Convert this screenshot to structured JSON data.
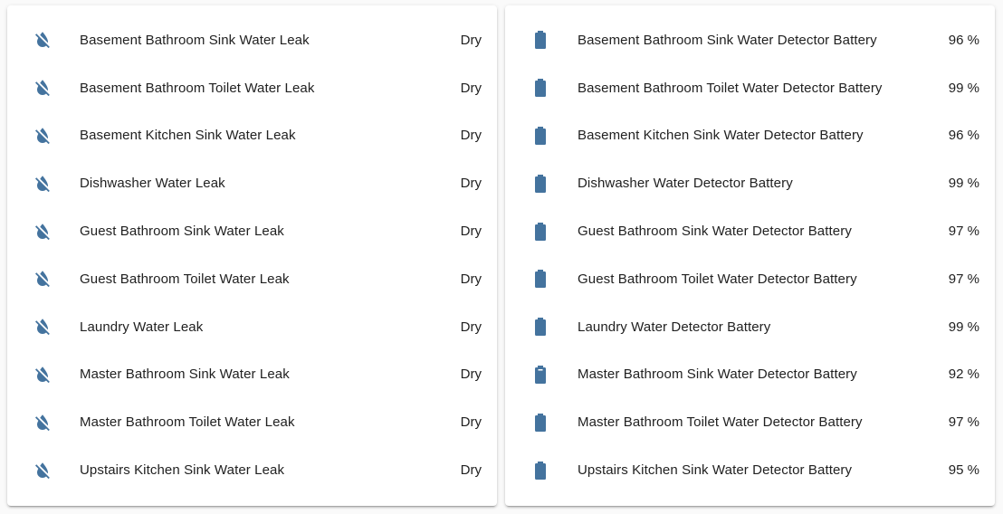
{
  "theme": {
    "icon_color": "#44739e"
  },
  "leak_card": {
    "rows": [
      {
        "name": "Basement Bathroom Sink Water Leak",
        "state": "Dry",
        "icon": "water-off-icon"
      },
      {
        "name": "Basement Bathroom Toilet Water Leak",
        "state": "Dry",
        "icon": "water-off-icon"
      },
      {
        "name": "Basement Kitchen Sink Water Leak",
        "state": "Dry",
        "icon": "water-off-icon"
      },
      {
        "name": "Dishwasher Water Leak",
        "state": "Dry",
        "icon": "water-off-icon"
      },
      {
        "name": "Guest Bathroom Sink Water Leak",
        "state": "Dry",
        "icon": "water-off-icon"
      },
      {
        "name": "Guest Bathroom Toilet Water Leak",
        "state": "Dry",
        "icon": "water-off-icon"
      },
      {
        "name": "Laundry Water Leak",
        "state": "Dry",
        "icon": "water-off-icon"
      },
      {
        "name": "Master Bathroom Sink Water Leak",
        "state": "Dry",
        "icon": "water-off-icon"
      },
      {
        "name": "Master Bathroom Toilet Water Leak",
        "state": "Dry",
        "icon": "water-off-icon"
      },
      {
        "name": "Upstairs Kitchen Sink Water Leak",
        "state": "Dry",
        "icon": "water-off-icon"
      }
    ]
  },
  "battery_card": {
    "rows": [
      {
        "name": "Basement Bathroom Sink Water Detector Battery",
        "state": "96 %",
        "icon": "battery-icon",
        "level": 96
      },
      {
        "name": "Basement Bathroom Toilet Water Detector Battery",
        "state": "99 %",
        "icon": "battery-icon",
        "level": 99
      },
      {
        "name": "Basement Kitchen Sink Water Detector Battery",
        "state": "96 %",
        "icon": "battery-icon",
        "level": 96
      },
      {
        "name": "Dishwasher Water Detector Battery",
        "state": "99 %",
        "icon": "battery-icon",
        "level": 99
      },
      {
        "name": "Guest Bathroom Sink Water Detector Battery",
        "state": "97 %",
        "icon": "battery-icon",
        "level": 97
      },
      {
        "name": "Guest Bathroom Toilet Water Detector Battery",
        "state": "97 %",
        "icon": "battery-icon",
        "level": 97
      },
      {
        "name": "Laundry Water Detector Battery",
        "state": "99 %",
        "icon": "battery-icon",
        "level": 99
      },
      {
        "name": "Master Bathroom Sink Water Detector Battery",
        "state": "92 %",
        "icon": "battery-90-icon",
        "level": 92
      },
      {
        "name": "Master Bathroom Toilet Water Detector Battery",
        "state": "97 %",
        "icon": "battery-icon",
        "level": 97
      },
      {
        "name": "Upstairs Kitchen Sink Water Detector Battery",
        "state": "95 %",
        "icon": "battery-icon",
        "level": 95
      }
    ]
  }
}
